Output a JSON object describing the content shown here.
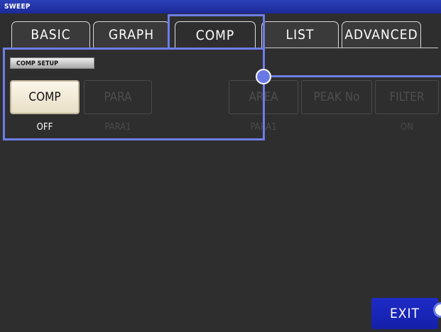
{
  "window": {
    "title": "SWEEP"
  },
  "tabs": [
    {
      "label": "BASIC"
    },
    {
      "label": "GRAPH"
    },
    {
      "label": "COMP"
    },
    {
      "label": "LIST"
    },
    {
      "label": "ADVANCED"
    }
  ],
  "active_tab": "COMP",
  "section": {
    "label": "COMP SETUP"
  },
  "settings": [
    {
      "label": "COMP",
      "value": "OFF",
      "enabled": true
    },
    {
      "label": "PARA",
      "value": "PARA1",
      "enabled": false
    },
    {
      "label": "AREA",
      "value": "PARA1",
      "enabled": false
    },
    {
      "label": "PEAK No",
      "value": "",
      "enabled": false
    },
    {
      "label": "FILTER",
      "value": "ON",
      "enabled": false
    }
  ],
  "exit_button": {
    "label": "EXIT"
  },
  "colors": {
    "title_bar": "#1c2a96",
    "exit_button": "#1420a8",
    "callout": "#6d7ee8",
    "background": "#2e2e2e"
  }
}
